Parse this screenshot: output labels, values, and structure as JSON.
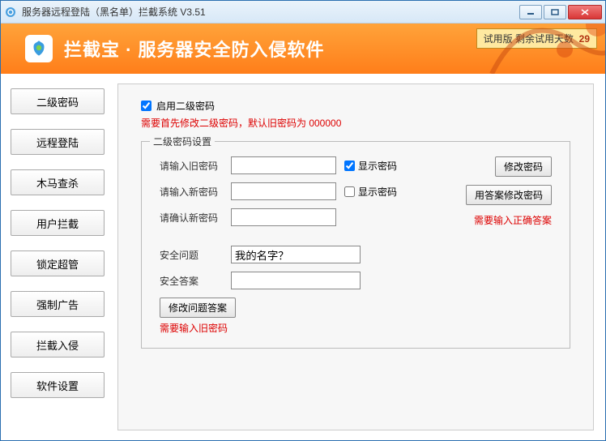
{
  "window": {
    "title": "服务器远程登陆（黑名单）拦截系统 V3.51"
  },
  "banner": {
    "title": "拦截宝 · 服务器安全防入侵软件",
    "trial_label": "试用版 剩余试用天数",
    "trial_days": "29"
  },
  "sidebar": {
    "items": [
      {
        "label": "二级密码"
      },
      {
        "label": "远程登陆"
      },
      {
        "label": "木马查杀"
      },
      {
        "label": "用户拦截"
      },
      {
        "label": "锁定超管"
      },
      {
        "label": "强制广告"
      },
      {
        "label": "拦截入侵"
      },
      {
        "label": "软件设置"
      }
    ]
  },
  "main": {
    "enable_label": "启用二级密码",
    "enable_checked": true,
    "enable_note": "需要首先修改二级密码，默认旧密码为 000000",
    "fieldset_legend": "二级密码设置",
    "old_pwd_label": "请输入旧密码",
    "new_pwd_label": "请输入新密码",
    "confirm_pwd_label": "请确认新密码",
    "show_pwd_label": "显示密码",
    "show_old_checked": true,
    "show_new_checked": false,
    "change_pwd_btn": "修改密码",
    "change_by_answer_btn": "用答案修改密码",
    "need_answer_note": "需要输入正确答案",
    "question_label": "安全问题",
    "question_value": "我的名字？",
    "answer_label": "安全答案",
    "change_qa_btn": "修改问题答案",
    "need_old_pwd_note": "需要输入旧密码"
  }
}
